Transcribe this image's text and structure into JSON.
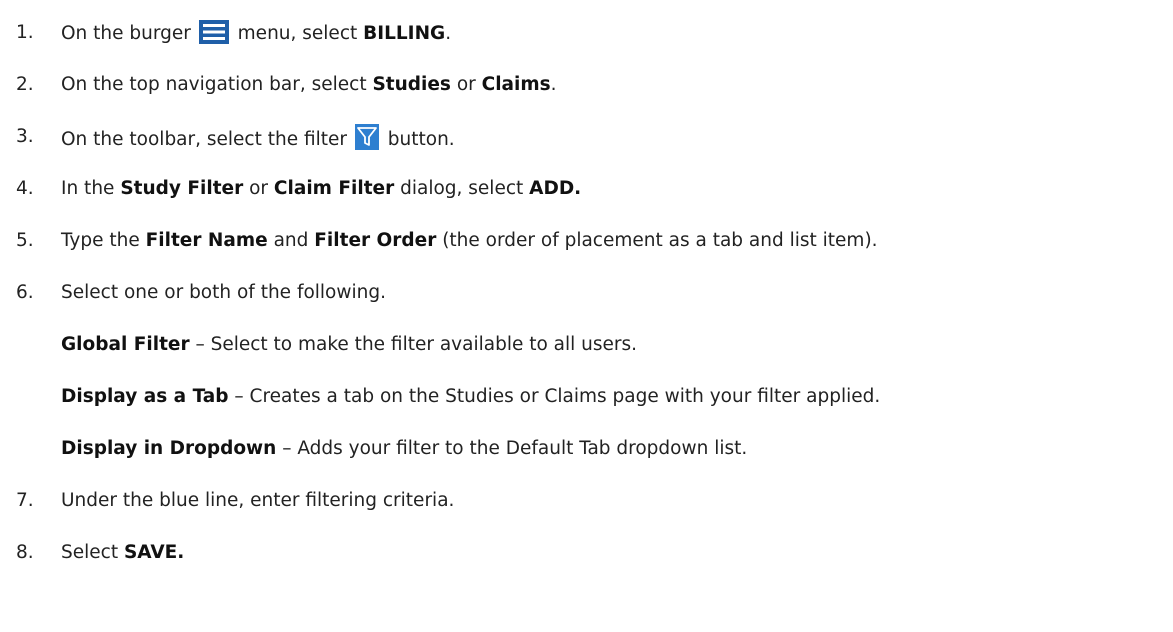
{
  "steps": [
    {
      "num": "1.",
      "a": "On the burger ",
      "icon": "burger-menu-icon",
      "b": " menu, select ",
      "c": "BILLING",
      "d": "."
    },
    {
      "num": "2.",
      "a": "On the top navigation bar, select ",
      "b": "Studies",
      "c": " or ",
      "d": "Claims",
      "e": "."
    },
    {
      "num": "3.",
      "a": "On the toolbar, select the filter ",
      "icon": "filter-icon",
      "b": " button."
    },
    {
      "num": "4.",
      "a": "In the ",
      "b": "Study Filter",
      "c": " or ",
      "d": "Claim Filter",
      "e": " dialog, select ",
      "f": "ADD."
    },
    {
      "num": "5.",
      "a": "Type the ",
      "b": "Filter Name",
      "c": " and ",
      "d": "Filter Order",
      "e": " (the order of placement as a tab and list item)."
    },
    {
      "num": "6.",
      "a": "Select one or both of the following."
    },
    {
      "num": "7.",
      "a": "Under the blue line, enter filtering criteria."
    },
    {
      "num": "8.",
      "a": "Select ",
      "b": "SAVE."
    }
  ],
  "options": [
    {
      "term": "Global Filter",
      "desc": " – Select to make the filter available to all users."
    },
    {
      "term": "Display as a Tab",
      "desc": " – Creates a tab on the Studies or Claims page with your filter applied."
    },
    {
      "term": "Display in Dropdown",
      "desc": " – Adds your filter to the Default Tab dropdown list."
    }
  ],
  "colors": {
    "burger_icon": "#1f5fa8",
    "filter_icon_bg": "#2e7fd0",
    "filter_icon_fg": "#ffffff"
  }
}
